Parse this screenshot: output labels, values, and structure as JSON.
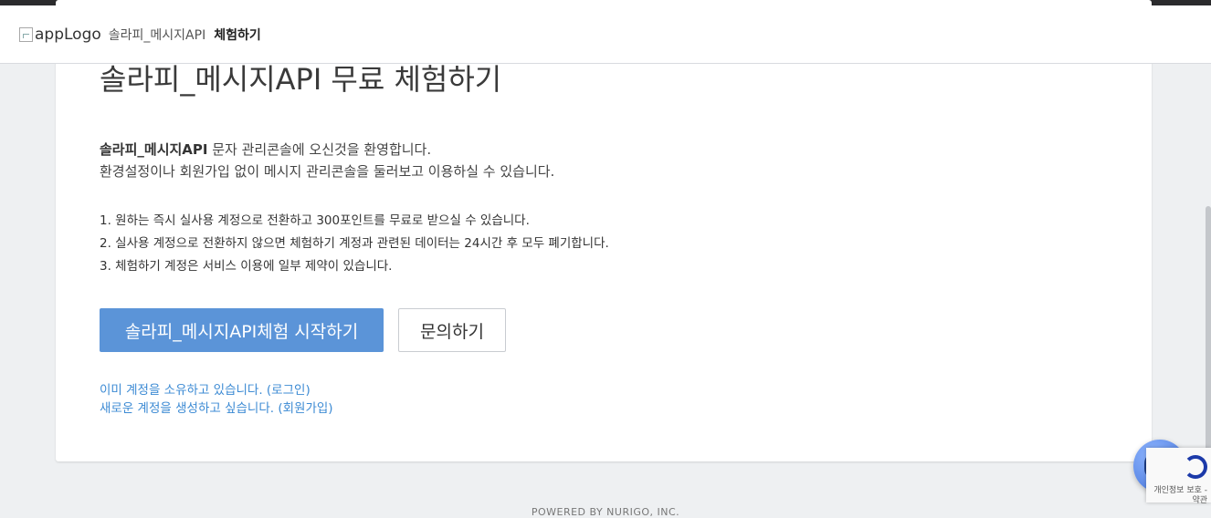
{
  "header": {
    "logo_alt": "appLogo",
    "breadcrumb_app": "솔라피_메시지API",
    "breadcrumb_current": "체험하기"
  },
  "main": {
    "title": "솔라피_메시지API 무료 체험하기",
    "welcome_brand": "솔라피_메시지API",
    "welcome_rest": " 문자 관리콘솔에 오신것을 환영합니다.",
    "welcome_line2": "환경설정이나 회원가입 없이 메시지 관리콘솔을 둘러보고 이용하실 수 있습니다.",
    "notes": [
      "1. 원하는 즉시 실사용 계정으로 전환하고 300포인트를 무료로 받으실 수 있습니다.",
      "2. 실사용 계정으로 전환하지 않으면 체험하기 계정과 관련된 데이터는 24시간 후 모두 폐기합니다.",
      "3. 체험하기 계정은 서비스 이용에 일부 제약이 있습니다."
    ],
    "start_button": "솔라피_메시지API체험 시작하기",
    "contact_button": "문의하기",
    "login_link": "이미 계정을 소유하고 있습니다. (로그인)",
    "signup_link": "새로운 계정을 생성하고 싶습니다. (회원가입)"
  },
  "footer": {
    "powered_by": "POWERED BY NURIGO, INC."
  },
  "recaptcha": {
    "text": "개인정보 보호 - 약관"
  },
  "colors": {
    "primary": "#5b94d8",
    "link": "#3d8bd4",
    "topbar": "#2b2b2d"
  }
}
